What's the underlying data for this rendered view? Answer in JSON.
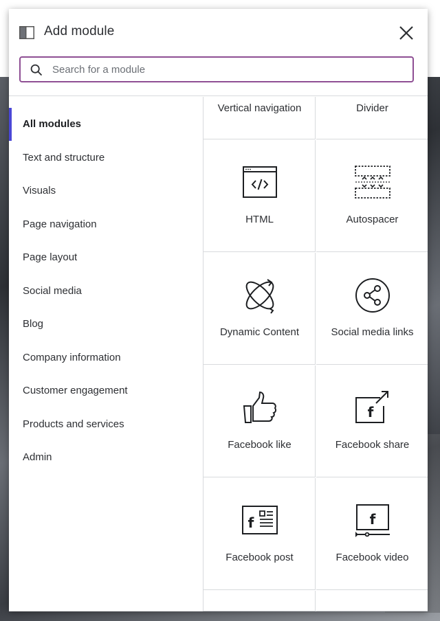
{
  "dialog": {
    "title": "Add module"
  },
  "search": {
    "placeholder": "Search for a module",
    "value": ""
  },
  "categories": [
    {
      "label": "All modules",
      "active": true
    },
    {
      "label": "Text and structure",
      "active": false
    },
    {
      "label": "Visuals",
      "active": false
    },
    {
      "label": "Page navigation",
      "active": false
    },
    {
      "label": "Page layout",
      "active": false
    },
    {
      "label": "Social media",
      "active": false
    },
    {
      "label": "Blog",
      "active": false
    },
    {
      "label": "Company information",
      "active": false
    },
    {
      "label": "Customer engagement",
      "active": false
    },
    {
      "label": "Products and services",
      "active": false
    },
    {
      "label": "Admin",
      "active": false
    }
  ],
  "modules": [
    {
      "label": "Vertical navigation",
      "icon": "vertical-navigation-icon"
    },
    {
      "label": "Divider",
      "icon": "divider-icon"
    },
    {
      "label": "HTML",
      "icon": "html-code-icon"
    },
    {
      "label": "Autospacer",
      "icon": "autospacer-icon"
    },
    {
      "label": "Dynamic Content",
      "icon": "dynamic-content-icon"
    },
    {
      "label": "Social media links",
      "icon": "share-icon"
    },
    {
      "label": "Facebook like",
      "icon": "thumbs-up-icon"
    },
    {
      "label": "Facebook share",
      "icon": "facebook-share-icon"
    },
    {
      "label": "Facebook post",
      "icon": "facebook-post-icon"
    },
    {
      "label": "Facebook video",
      "icon": "facebook-video-icon"
    }
  ],
  "colors": {
    "search_border": "#8e4e93",
    "active_indicator": "#4a47d6",
    "text": "#2d2f33"
  }
}
